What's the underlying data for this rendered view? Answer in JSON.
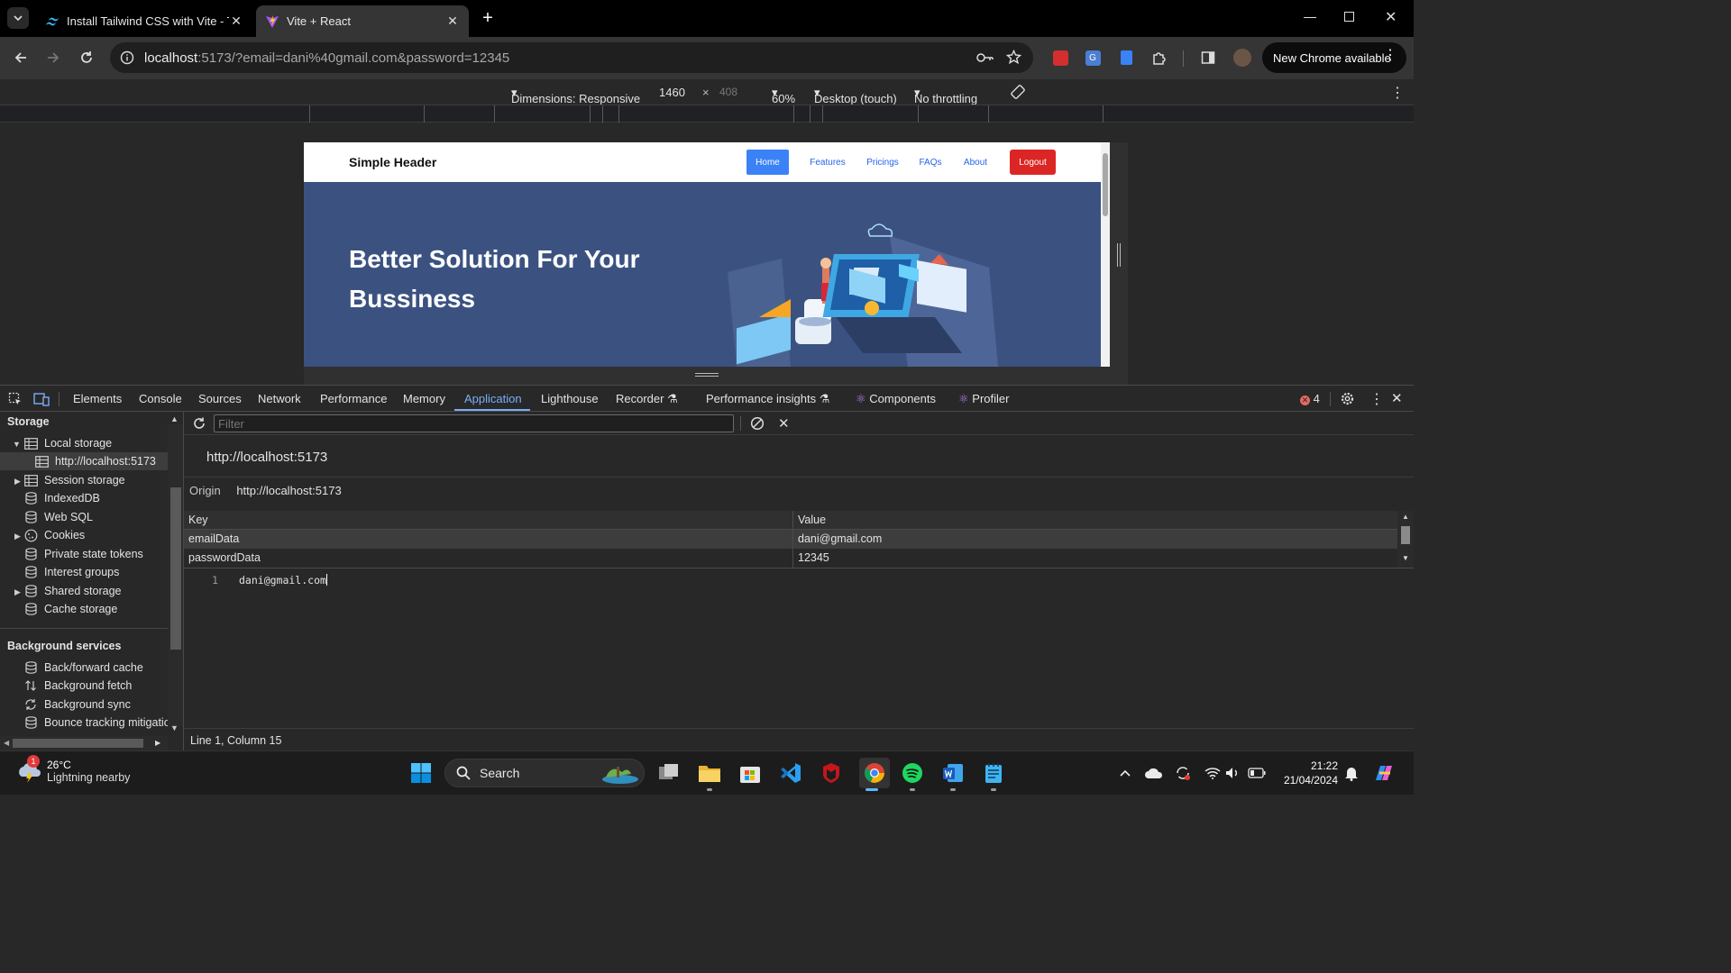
{
  "browser": {
    "tabs": [
      {
        "title": "Install Tailwind CSS with Vite - T",
        "active": false
      },
      {
        "title": "Vite + React",
        "active": true
      }
    ],
    "url_host": "localhost",
    "url_rest": ":5173/?email=dani%40gmail.com&password=12345",
    "new_chrome_label": "New Chrome available"
  },
  "device_toolbar": {
    "dimensions": "Dimensions: Responsive",
    "width": "1460",
    "times": "×",
    "height": "408",
    "zoom": "60%",
    "device": "Desktop (touch)",
    "throttling": "No throttling"
  },
  "site": {
    "brand": "Simple Header",
    "nav": [
      "Home",
      "Features",
      "Pricings",
      "FAQs",
      "About"
    ],
    "logout": "Logout",
    "hero_title": "Better Solution For Your Bussiness"
  },
  "devtools": {
    "tabs": [
      "Elements",
      "Console",
      "Sources",
      "Network",
      "Performance",
      "Memory",
      "Application",
      "Lighthouse",
      "Recorder",
      "Performance insights",
      "Components",
      "Profiler"
    ],
    "active_tab": "Application",
    "error_count": "4",
    "sidebar": {
      "storage_heading": "Storage",
      "storage_items": [
        "Local storage",
        "http://localhost:5173",
        "Session storage",
        "IndexedDB",
        "Web SQL",
        "Cookies",
        "Private state tokens",
        "Interest groups",
        "Shared storage",
        "Cache storage"
      ],
      "background_heading": "Background services",
      "background_items": [
        "Back/forward cache",
        "Background fetch",
        "Background sync",
        "Bounce tracking mitigatio"
      ]
    },
    "filter_placeholder": "Filter",
    "origin_title": "http://localhost:5173",
    "origin_label": "Origin",
    "origin_value": "http://localhost:5173",
    "table": {
      "columns": [
        "Key",
        "Value"
      ],
      "rows": [
        {
          "key": "emailData",
          "value": "dani@gmail.com"
        },
        {
          "key": "passwordData",
          "value": "12345"
        }
      ]
    },
    "editor_line_number": "1",
    "editor_text": "dani@gmail.com",
    "status": "Line 1, Column 15"
  },
  "taskbar": {
    "weather_temp": "26°C",
    "weather_desc": "Lightning nearby",
    "weather_badge": "1",
    "search_label": "Search",
    "time": "21:22",
    "date": "21/04/2024"
  },
  "colors": {
    "accent": "#7cacf8",
    "hero_bg": "#3b5281",
    "home_btn": "#3b82f6",
    "logout_btn": "#dc2626"
  }
}
